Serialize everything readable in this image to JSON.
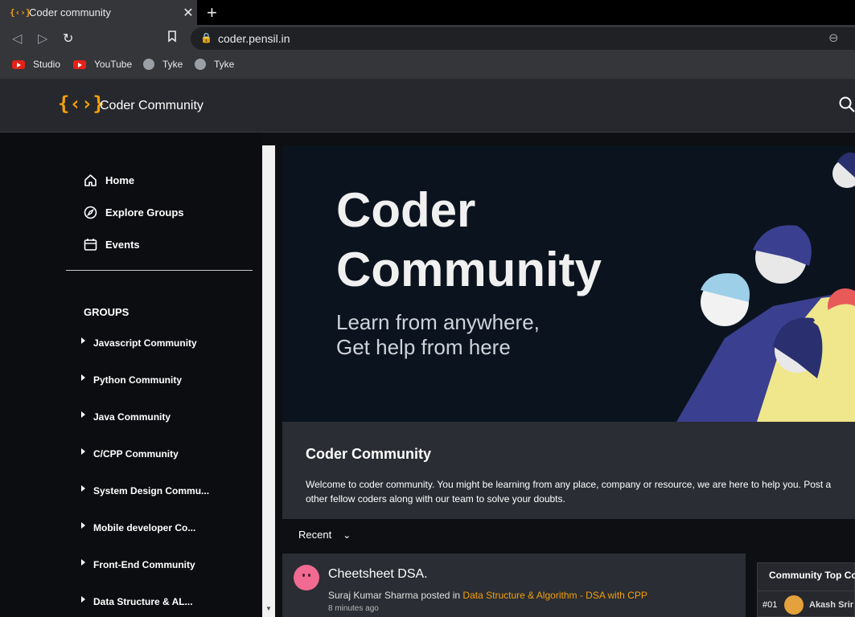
{
  "browser": {
    "tab_title": "Coder community",
    "tab_favicon": "{‹›}",
    "url": "coder.pensil.in",
    "bookmarks": [
      {
        "label": "Studio",
        "icon": "youtube-icon"
      },
      {
        "label": "YouTube",
        "icon": "youtube-icon"
      },
      {
        "label": "Tyke",
        "icon": "globe-icon"
      },
      {
        "label": "Tyke",
        "icon": "globe-icon"
      }
    ]
  },
  "header": {
    "logo": "{‹›}",
    "brand": "Coder Community"
  },
  "sidebar": {
    "nav": [
      {
        "label": "Home",
        "icon": "home-icon"
      },
      {
        "label": "Explore Groups",
        "icon": "compass-icon"
      },
      {
        "label": "Events",
        "icon": "calendar-icon"
      }
    ],
    "groups_title": "GROUPS",
    "groups": [
      "Javascript Community",
      "Python Community",
      "Java Community",
      "C/CPP Community",
      "System Design Commu...",
      "Mobile developer Co...",
      "Front-End Community",
      "Data Structure & AL..."
    ]
  },
  "hero": {
    "title_line1": "Coder",
    "title_line2": "Community",
    "subtitle_line1": "Learn from anywhere,",
    "subtitle_line2": "Get help from here"
  },
  "about": {
    "title": "Coder Community",
    "desc_line1": "Welcome to coder community. You might be learning from any place, company or resource, we are here to help you. Post a",
    "desc_line2": "other fellow coders along with our team to solve your doubts."
  },
  "feed": {
    "sort_label": "Recent",
    "post": {
      "title": "Cheetsheet DSA.",
      "author": "Suraj Kumar Sharma",
      "verb": " posted in ",
      "group": "Data Structure & Algorithm - DSA with CPP",
      "time": "8 minutes ago"
    }
  },
  "top_contributors": {
    "title": "Community Top Co",
    "entries": [
      {
        "rank": "#01",
        "name": "Akash Srir"
      }
    ]
  },
  "colors": {
    "accent": "#f3a008",
    "hero_bg": "#0b131e",
    "card_bg": "#2a2d33"
  }
}
